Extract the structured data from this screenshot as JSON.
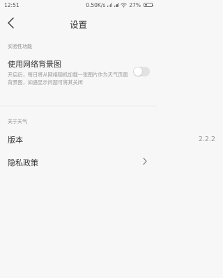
{
  "status_bar": {
    "time": "12:51",
    "network_speed": "0.50K/s",
    "battery": "27%"
  },
  "header": {
    "title": "设置",
    "back_icon": "chevron-left-icon"
  },
  "experimental": {
    "section_label": "实验性功能",
    "background_title": "使用网络背景图",
    "background_desc": "开启后，每日将从网络随机加载一张图片作为天气页面背景图，如遇显示问题可将其关闭",
    "toggle_on": false
  },
  "about": {
    "section_label": "关于天气",
    "version_label": "版本",
    "version_value": "2.2.2",
    "privacy_label": "隐私政策",
    "privacy_icon": "chevron-right-icon"
  }
}
